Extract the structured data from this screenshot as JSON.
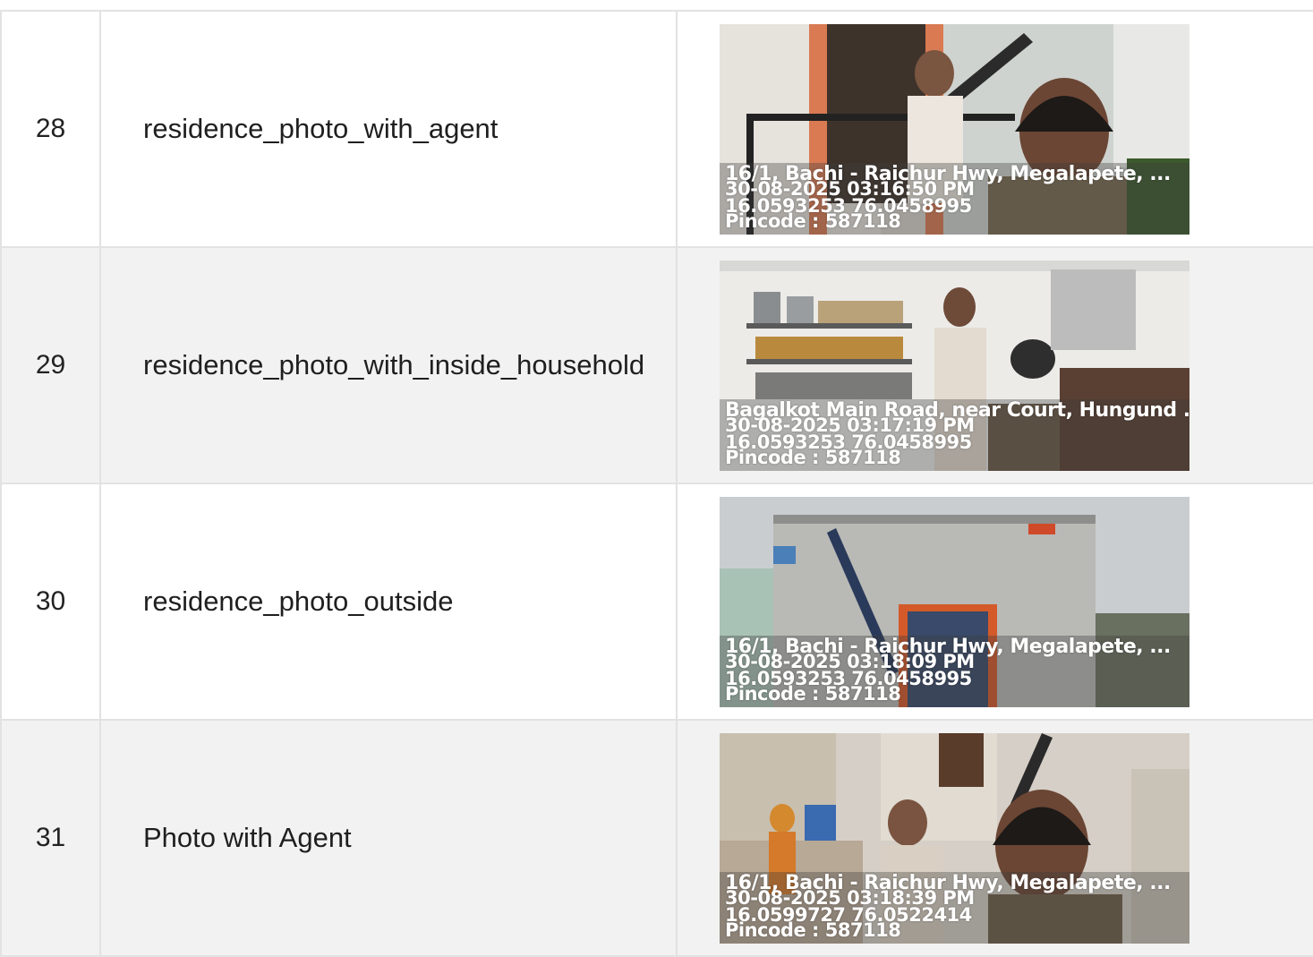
{
  "rows": [
    {
      "number": "28",
      "label": "residence_photo_with_agent",
      "photo": {
        "address": "16/1, Bachi - Raichur Hwy, Megalapete, ...",
        "timestamp": "30-08-2025 03:16:50 PM",
        "coordinates": "16.0593253 76.0458995",
        "pincode": "Pincode : 587118"
      }
    },
    {
      "number": "29",
      "label": "residence_photo_with_inside_household",
      "photo": {
        "address": "Bagalkot Main Road, near Court, Hungund ...",
        "timestamp": "30-08-2025 03:17:19 PM",
        "coordinates": "16.0593253 76.0458995",
        "pincode": "Pincode : 587118"
      }
    },
    {
      "number": "30",
      "label": "residence_photo_outside",
      "photo": {
        "address": "16/1, Bachi - Raichur Hwy, Megalapete, ...",
        "timestamp": "30-08-2025 03:18:09 PM",
        "coordinates": "16.0593253 76.0458995",
        "pincode": "Pincode : 587118"
      }
    },
    {
      "number": "31",
      "label": "Photo with Agent",
      "photo": {
        "address": "16/1, Bachi - Raichur Hwy, Megalapete, ...",
        "timestamp": "30-08-2025 03:18:39 PM",
        "coordinates": "16.0599727 76.0522414",
        "pincode": "Pincode : 587118"
      }
    }
  ],
  "colors": {
    "row_alt": "#f2f2f2",
    "border": "#e2e2e2",
    "overlay_text": "#ffffff"
  }
}
